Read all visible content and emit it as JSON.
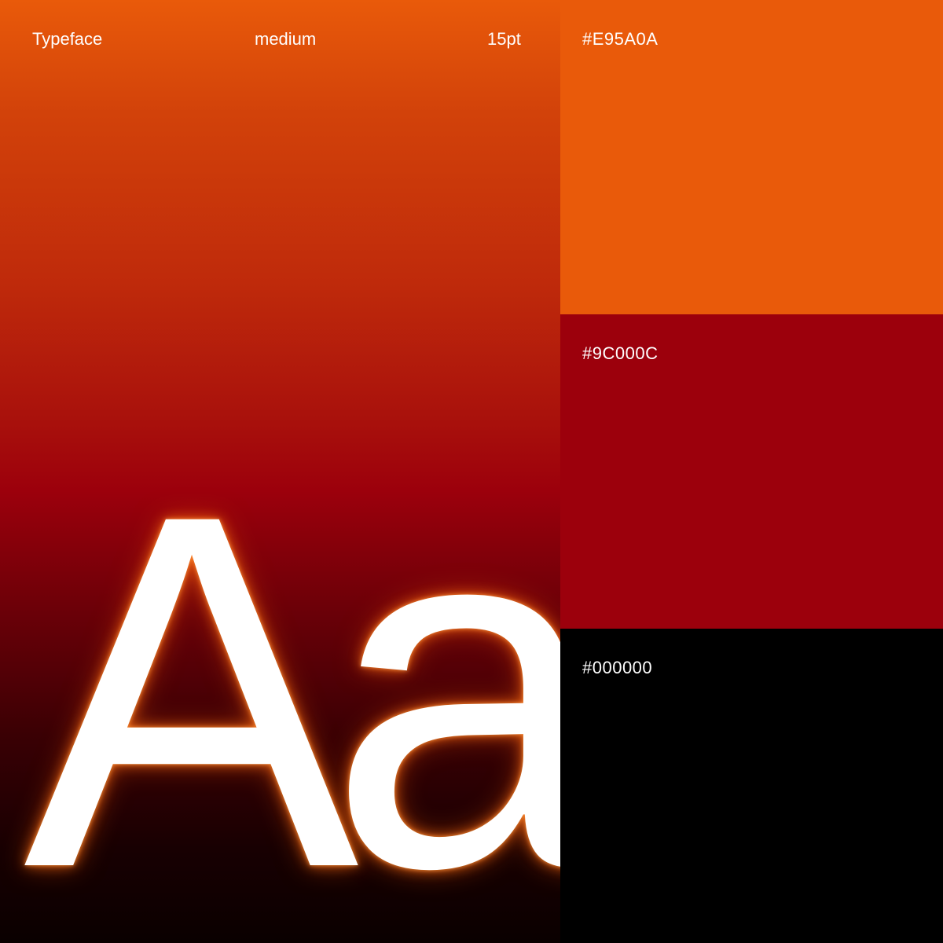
{
  "header": {
    "typeface_label": "Typeface",
    "weight": "medium",
    "size": "15pt"
  },
  "specimen": {
    "glyphs": "Aa"
  },
  "palette": [
    {
      "hex": "#E95A0A",
      "label": "#E95A0A"
    },
    {
      "hex": "#9C000C",
      "label": "#9C000C"
    },
    {
      "hex": "#000000",
      "label": "#000000"
    }
  ]
}
